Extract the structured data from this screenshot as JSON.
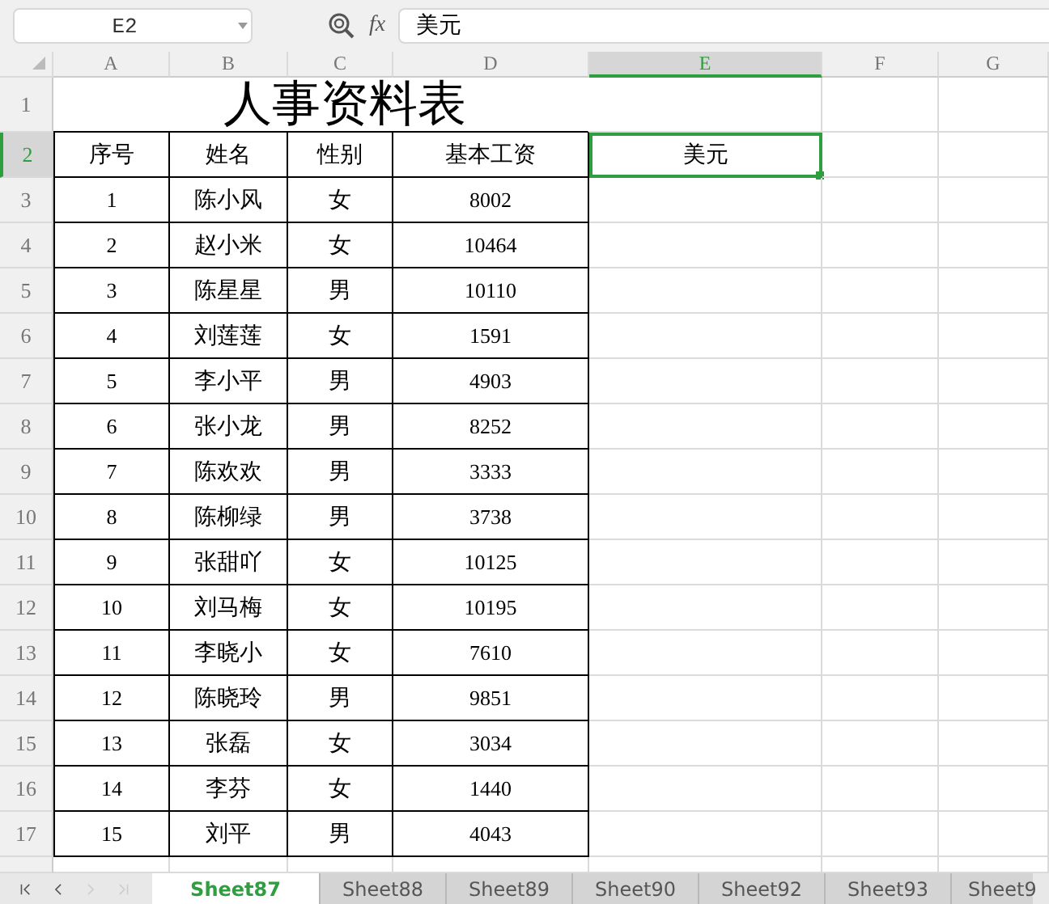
{
  "name_box": "E2",
  "function_label": "fx",
  "formula": "美元",
  "columns": [
    {
      "label": "A",
      "selected": false
    },
    {
      "label": "B",
      "selected": false
    },
    {
      "label": "C",
      "selected": false
    },
    {
      "label": "D",
      "selected": false
    },
    {
      "label": "E",
      "selected": true
    },
    {
      "label": "F",
      "selected": false
    },
    {
      "label": "G",
      "selected": false
    }
  ],
  "row_headers": [
    {
      "label": "1",
      "selected": false
    },
    {
      "label": "2",
      "selected": true
    },
    {
      "label": "3",
      "selected": false
    },
    {
      "label": "4",
      "selected": false
    },
    {
      "label": "5",
      "selected": false
    },
    {
      "label": "6",
      "selected": false
    },
    {
      "label": "7",
      "selected": false
    },
    {
      "label": "8",
      "selected": false
    },
    {
      "label": "9",
      "selected": false
    },
    {
      "label": "10",
      "selected": false
    },
    {
      "label": "11",
      "selected": false
    },
    {
      "label": "12",
      "selected": false
    },
    {
      "label": "13",
      "selected": false
    },
    {
      "label": "14",
      "selected": false
    },
    {
      "label": "15",
      "selected": false
    },
    {
      "label": "16",
      "selected": false
    },
    {
      "label": "17",
      "selected": false
    }
  ],
  "title": "人事资料表",
  "table": {
    "columns": [
      "序号",
      "姓名",
      "性别",
      "基本工资"
    ],
    "rows": [
      [
        "1",
        "陈小风",
        "女",
        "8002"
      ],
      [
        "2",
        "赵小米",
        "女",
        "10464"
      ],
      [
        "3",
        "陈星星",
        "男",
        "10110"
      ],
      [
        "4",
        "刘莲莲",
        "女",
        "1591"
      ],
      [
        "5",
        "李小平",
        "男",
        "4903"
      ],
      [
        "6",
        "张小龙",
        "男",
        "8252"
      ],
      [
        "7",
        "陈欢欢",
        "男",
        "3333"
      ],
      [
        "8",
        "陈柳绿",
        "男",
        "3738"
      ],
      [
        "9",
        "张甜吖",
        "女",
        "10125"
      ],
      [
        "10",
        "刘马梅",
        "女",
        "10195"
      ],
      [
        "11",
        "李晓小",
        "女",
        "7610"
      ],
      [
        "12",
        "陈晓玲",
        "男",
        "9851"
      ],
      [
        "13",
        "张磊",
        "女",
        "3034"
      ],
      [
        "14",
        "李芬",
        "女",
        "1440"
      ],
      [
        "15",
        "刘平",
        "男",
        "4043"
      ]
    ]
  },
  "active_cell": {
    "text": "美元",
    "selected": true
  },
  "nav": [
    {
      "kind": "first",
      "disabled": false
    },
    {
      "kind": "prev",
      "disabled": false
    },
    {
      "kind": "next",
      "disabled": true
    },
    {
      "kind": "last",
      "disabled": true
    }
  ],
  "sheet_tabs": [
    {
      "label": "Sheet87",
      "selected": true
    },
    {
      "label": "Sheet88",
      "selected": false
    },
    {
      "label": "Sheet89",
      "selected": false
    },
    {
      "label": "Sheet90",
      "selected": false
    },
    {
      "label": "Sheet92",
      "selected": false
    },
    {
      "label": "Sheet93",
      "selected": false
    },
    {
      "label": "Sheet9",
      "selected": false
    }
  ]
}
